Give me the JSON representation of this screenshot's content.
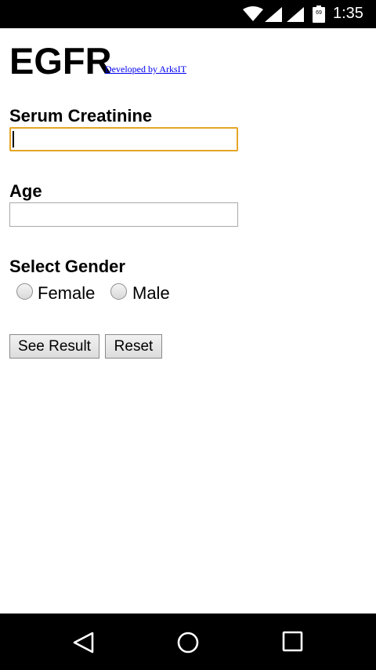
{
  "status_bar": {
    "time": "1:35",
    "battery_level": "69",
    "icons": [
      "wifi-icon",
      "signal-icon",
      "signal-icon",
      "battery-icon"
    ]
  },
  "app": {
    "title": "EGFR",
    "developer_link": "Developed by ArksIT"
  },
  "form": {
    "creatinine_label": "Serum Creatinine",
    "creatinine_value": "",
    "age_label": "Age",
    "age_value": "",
    "gender_label": "Select Gender",
    "gender_options": [
      "Female",
      "Male"
    ],
    "submit_label": "See Result",
    "reset_label": "Reset"
  },
  "nav_bar": {
    "icons": [
      "back-icon",
      "home-icon",
      "recents-icon"
    ]
  },
  "colors": {
    "focus_border": "#e5a526",
    "link": "#0000ee",
    "bar_background": "#000000"
  }
}
